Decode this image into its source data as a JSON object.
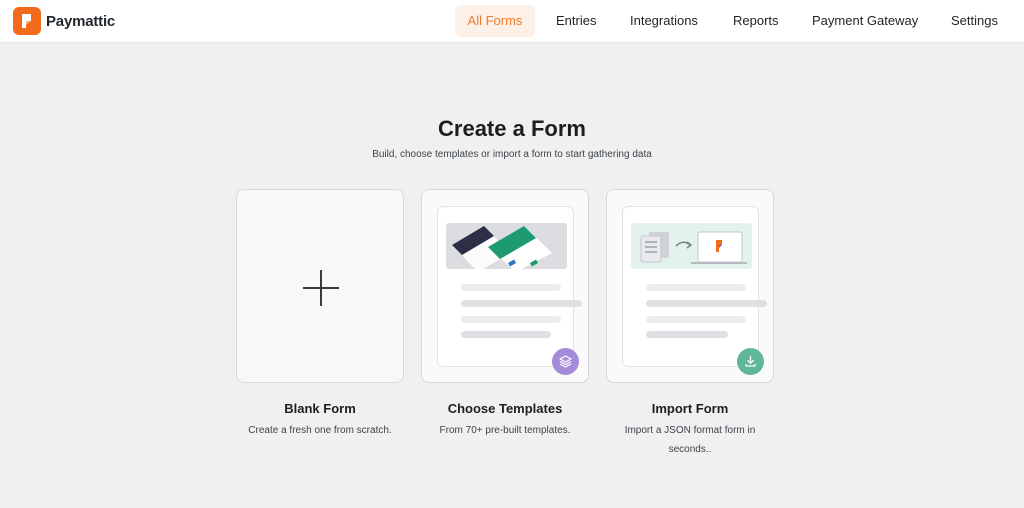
{
  "app": {
    "name": "Paymattic"
  },
  "nav": {
    "items": [
      {
        "label": "All Forms",
        "active": true
      },
      {
        "label": "Entries"
      },
      {
        "label": "Integrations"
      },
      {
        "label": "Reports"
      },
      {
        "label": "Payment Gateway"
      },
      {
        "label": "Settings"
      }
    ]
  },
  "hero": {
    "title": "Create a Form",
    "subtitle": "Build, choose templates or import a form to start gathering data"
  },
  "cards": [
    {
      "title": "Blank Form",
      "description": "Create a fresh one from scratch.",
      "icon": "plus-icon"
    },
    {
      "title": "Choose Templates",
      "description": "From 70+ pre-built templates.",
      "icon": "layers-icon"
    },
    {
      "title": "Import Form",
      "description": "Import a JSON format form in seconds..",
      "icon": "download-icon"
    }
  ],
  "colors": {
    "brand": "#f26a1b",
    "active_nav_bg": "#fdf0e6",
    "active_nav_text": "#f27c2e",
    "template_badge": "#a78bdb",
    "import_badge": "#5fb69a",
    "template_green": "#1e9a72",
    "template_dark": "#2b3046"
  }
}
